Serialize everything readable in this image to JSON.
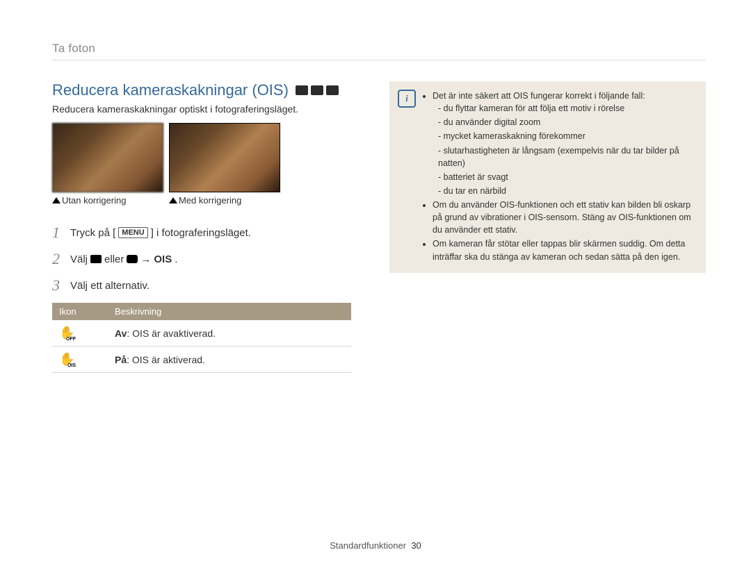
{
  "breadcrumb": "Ta foton",
  "title": "Reducera kameraskakningar (OIS)",
  "subtitle": "Reducera kameraskakningar optiskt i fotograferingsläget.",
  "samples": {
    "before": "Utan korrigering",
    "after": "Med korrigering"
  },
  "steps": {
    "s1_a": "Tryck på [",
    "s1_menu": "MENU",
    "s1_b": "] i fotograferingsläget.",
    "s2_a": "Välj",
    "s2_b": "eller",
    "s2_c": "→",
    "s2_d": "OIS",
    "s2_e": ".",
    "s3": "Välj ett alternativ."
  },
  "table": {
    "headers": {
      "icon": "Ikon",
      "desc": "Beskrivning"
    },
    "rows": [
      {
        "icon_sub": "OFF",
        "label": "Av",
        "desc": ": OIS är avaktiverad."
      },
      {
        "icon_sub": "OIS",
        "label": "På",
        "desc": ": OIS är aktiverad."
      }
    ]
  },
  "note": {
    "b1": "Det är inte säkert att OIS fungerar korrekt i följande fall:",
    "b1_sub": [
      "du flyttar kameran för att följa ett motiv i rörelse",
      "du använder digital zoom",
      "mycket kameraskakning förekommer",
      "slutarhastigheten är långsam (exempelvis när du tar bilder på natten)",
      "batteriet är svagt",
      "du tar en närbild"
    ],
    "b2": "Om du använder OIS-funktionen och ett stativ kan bilden bli oskarp på grund av vibrationer i OIS-sensorn. Stäng av OIS-funktionen om du använder ett stativ.",
    "b3": "Om kameran får stötar eller tappas blir skärmen suddig. Om detta inträffar ska du stänga av kameran och sedan sätta på den igen."
  },
  "footer": {
    "section": "Standardfunktioner",
    "page": "30"
  }
}
